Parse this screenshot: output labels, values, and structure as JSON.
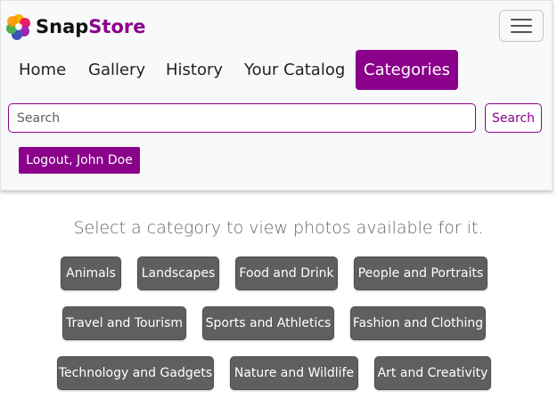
{
  "brand": {
    "name_part1": "Snap",
    "name_part2": "Store",
    "logo_icon": "flower-logo-icon",
    "accent_color": "#8b008b"
  },
  "navbar": {
    "toggler_icon": "hamburger-menu-icon",
    "links": [
      {
        "label": "Home",
        "active": false
      },
      {
        "label": "Gallery",
        "active": false
      },
      {
        "label": "History",
        "active": false
      },
      {
        "label": "Your Catalog",
        "active": false
      },
      {
        "label": "Categories",
        "active": true
      }
    ]
  },
  "search": {
    "placeholder": "Search",
    "value": "",
    "button_label": "Search"
  },
  "account": {
    "logout_label": "Logout, John Doe"
  },
  "main": {
    "intro_text": "Select a category to view photos available for it.",
    "categories": [
      "Animals",
      "Landscapes",
      "Food and Drink",
      "People and Portraits",
      "Travel and Tourism",
      "Sports and Athletics",
      "Fashion and Clothing",
      "Technology and Gadgets",
      "Nature and Wildlife",
      "Art and Creativity"
    ],
    "category_button_color": "#5f5f5f"
  }
}
